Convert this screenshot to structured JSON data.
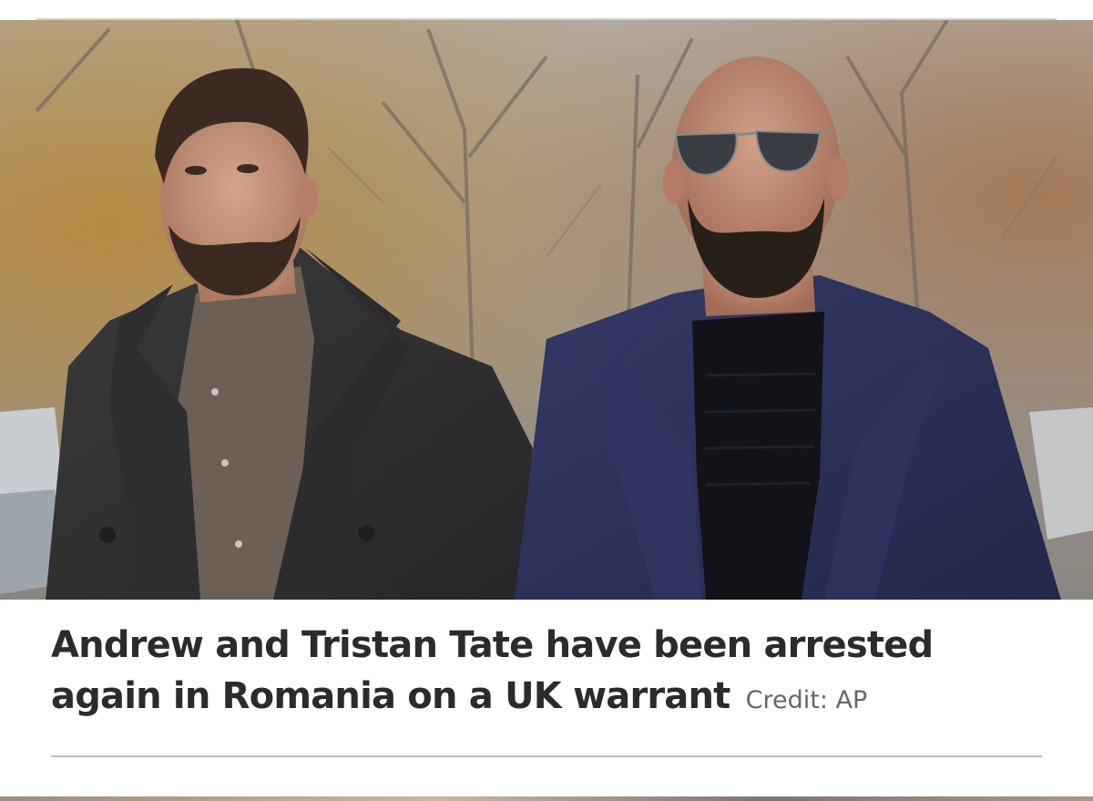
{
  "article": {
    "headline_text": "Andrew and Tristan Tate have been arrested again in Romania on a UK warrant",
    "credit_text": "Credit: AP"
  },
  "photo": {
    "semantic": "news-photo"
  },
  "colors": {
    "headline": "#2b2b2b",
    "credit": "#666666",
    "rule": "#bdbdbd"
  }
}
